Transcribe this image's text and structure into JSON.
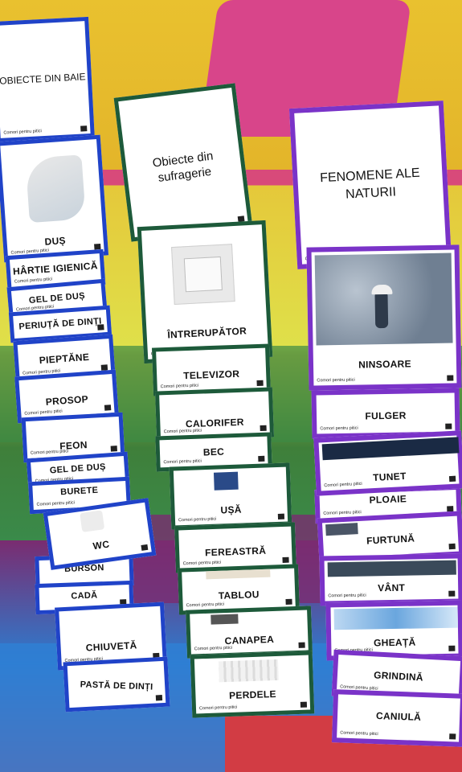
{
  "photo": {
    "brand_tag": "Comori pentru pitici",
    "columns": [
      {
        "title": "OBIECTE DIN BAIE",
        "cards": [
          "DUȘ",
          "HÂRTIE IGIENICĂ",
          "GEL DE DUȘ",
          "PERIUȚĂ DE DINȚI",
          "PIEPTĂNE",
          "PROSOP",
          "FEON",
          "GEL DE DUȘ",
          "BURETE",
          "WC",
          "BURSON",
          "CADĂ",
          "CHIUVETĂ",
          "PASTĂ DE DINȚI"
        ]
      },
      {
        "title": "Obiecte din sufragerie",
        "cards": [
          "ÎNTRERUPĂTOR",
          "TELEVIZOR",
          "CALORIFER",
          "BEC",
          "UȘĂ",
          "FEREASTRĂ",
          "TABLOU",
          "CANAPEA",
          "PERDELE"
        ]
      },
      {
        "title": "FENOMENE ALE NATURII",
        "cards": [
          "NINSOARE",
          "FULGER",
          "TUNET",
          "PLOAIE",
          "FURTUNĂ",
          "VÂNT",
          "GHEAȚĂ",
          "GRINDINĂ",
          "CANIULĂ"
        ]
      }
    ],
    "colors": {
      "bathroom_border": "#2043c8",
      "living_border": "#1d5a3a",
      "nature_border": "#7a33c8"
    }
  }
}
